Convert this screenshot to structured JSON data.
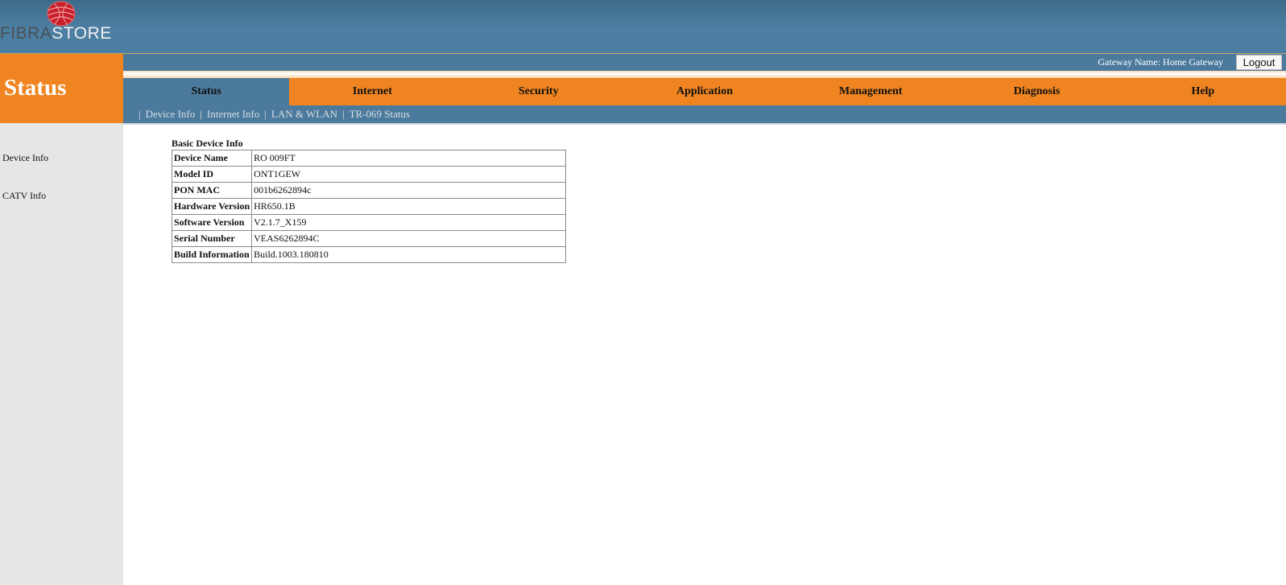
{
  "brand": {
    "logo_part1": "FIBRA",
    "logo_part2": "STORE"
  },
  "section_title": "Status",
  "gateway": {
    "label": "Gateway Name: Home Gateway",
    "logout_label": "Logout"
  },
  "main_nav": [
    {
      "label": "Status",
      "active": true
    },
    {
      "label": "Internet"
    },
    {
      "label": "Security"
    },
    {
      "label": "Application"
    },
    {
      "label": "Management"
    },
    {
      "label": "Diagnosis"
    },
    {
      "label": "Help"
    }
  ],
  "sub_nav": [
    "Device Info",
    "Internet Info",
    "LAN & WLAN",
    "TR-069 Status"
  ],
  "sidebar": [
    "Device Info",
    "CATV Info"
  ],
  "basic_device_info": {
    "title": "Basic Device Info",
    "rows": [
      {
        "label": "Device Name",
        "value": "RO 009FT"
      },
      {
        "label": "Model ID",
        "value": "ONT1GEW"
      },
      {
        "label": "PON MAC",
        "value": "001b6262894c"
      },
      {
        "label": "Hardware Version",
        "value": "HR650.1B"
      },
      {
        "label": "Software Version",
        "value": "V2.1.7_X159"
      },
      {
        "label": "Serial Number",
        "value": "VEAS6262894C"
      },
      {
        "label": "Build Information",
        "value": "Build.1003.180810"
      }
    ]
  },
  "colors": {
    "orange": "#ef8420",
    "blue": "#4b7a9c",
    "sidebar_gray": "#e6e6e6"
  }
}
